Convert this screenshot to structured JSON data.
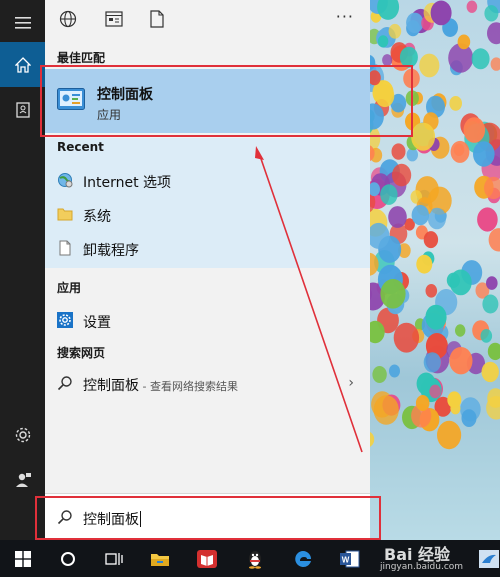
{
  "panel": {
    "best_match_header": "最佳匹配",
    "best_match": {
      "title": "控制面板",
      "subtitle": "应用"
    },
    "recent_header": "Recent",
    "recent_items": [
      {
        "label": "Internet 选项",
        "icon": "internet-options-icon"
      },
      {
        "label": "系统",
        "icon": "folder-icon"
      },
      {
        "label": "卸载程序",
        "icon": "document-icon"
      }
    ],
    "apps_header": "应用",
    "apps_items": [
      {
        "label": "设置",
        "icon": "settings-gear-icon"
      }
    ],
    "web_header": "搜索网页",
    "web_item": {
      "label": "控制面板",
      "suffix": " - 查看网络搜索结果"
    },
    "more": "···"
  },
  "search": {
    "query": "控制面板"
  },
  "watermark": {
    "brand": "Bai 经验",
    "url": "jingyan.baidu.com"
  },
  "colors": {
    "accent": "#0e5e94",
    "highlight": "#a9cfee",
    "annotation": "#e0303a"
  }
}
